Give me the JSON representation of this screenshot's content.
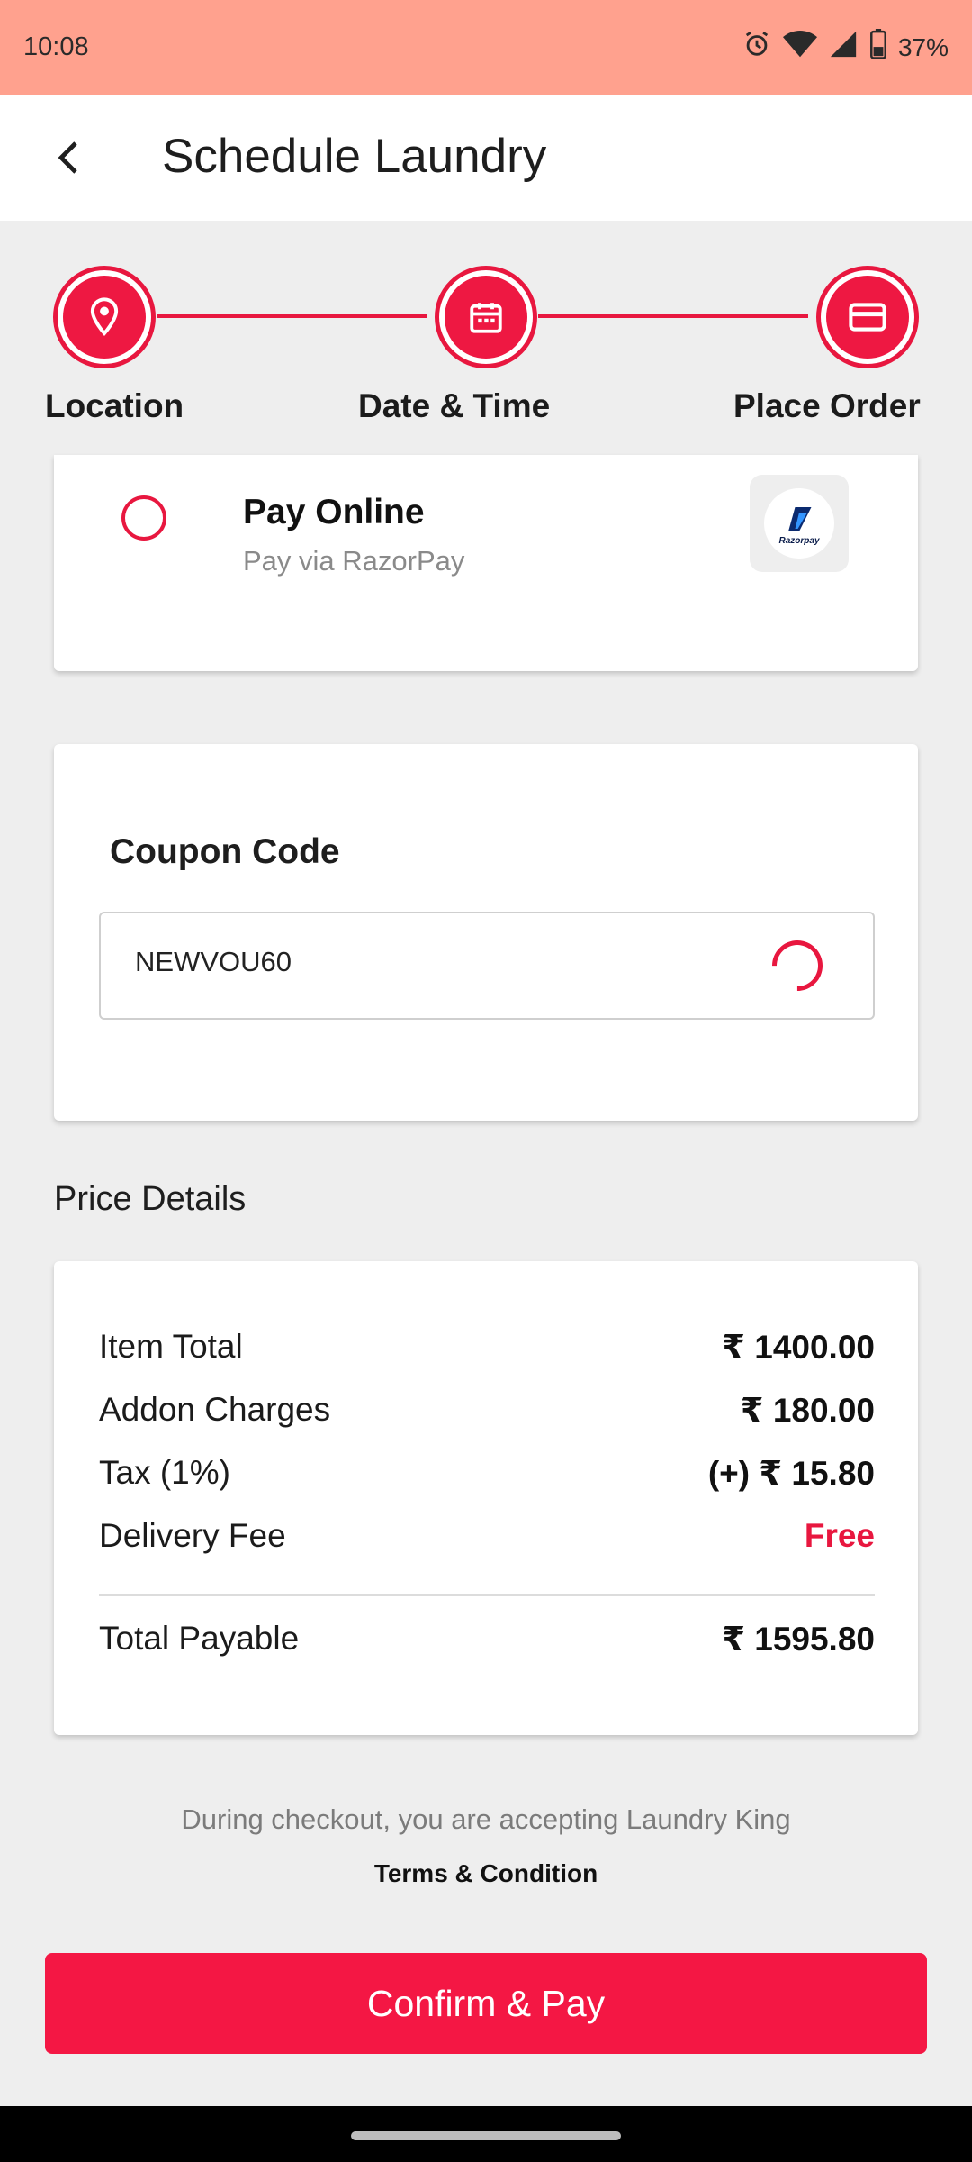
{
  "status_bar": {
    "time": "10:08",
    "battery": "37%",
    "icons": [
      "alarm-icon",
      "wifi-icon",
      "signal-icon",
      "battery-icon"
    ]
  },
  "app_bar": {
    "title": "Schedule Laundry",
    "back_icon": "chevron-left-icon"
  },
  "stepper": {
    "steps": [
      {
        "label": "Location",
        "icon": "location-pin-icon"
      },
      {
        "label": "Date & Time",
        "icon": "calendar-icon"
      },
      {
        "label": "Place Order",
        "icon": "credit-card-icon"
      }
    ]
  },
  "payment": {
    "option_title": "Pay Online",
    "option_subtitle": "Pay via RazorPay",
    "logo_text": "Razorpay",
    "selected": false
  },
  "coupon": {
    "title": "Coupon Code",
    "value": "NEWVOU60",
    "loading": true
  },
  "price_details": {
    "heading": "Price Details",
    "rows": [
      {
        "label": "Item Total",
        "value": "₹ 1400.00"
      },
      {
        "label": "Addon Charges",
        "value": "₹ 180.00"
      },
      {
        "label": "Tax (1%)",
        "value": "(+) ₹ 15.80"
      },
      {
        "label": "Delivery Fee",
        "value": "Free"
      }
    ],
    "total_label": "Total Payable",
    "total_value": "₹ 1595.80"
  },
  "terms": {
    "note": "During checkout, you are accepting Laundry King",
    "link": "Terms & Condition"
  },
  "confirm_button": "Confirm & Pay",
  "colors": {
    "accent": "#f41744",
    "status_bar": "#ffa18e",
    "background": "#eeeeee"
  }
}
